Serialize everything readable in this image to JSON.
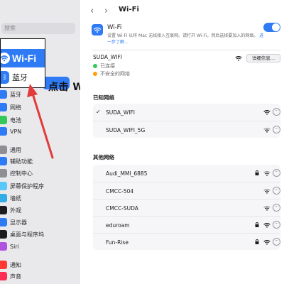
{
  "sidebar": {
    "search_placeholder": "搜索",
    "items": [
      {
        "label": "蓝牙",
        "icon": "bluetooth-icon",
        "color": "#2f7bf6"
      },
      {
        "label": "网络",
        "icon": "globe-icon",
        "color": "#2f7bf6"
      },
      {
        "label": "电池",
        "icon": "battery-icon",
        "color": "#34c759"
      },
      {
        "label": "VPN",
        "icon": "vpn-icon",
        "color": "#2f7bf6"
      },
      {
        "label": "通用",
        "icon": "gear-icon",
        "color": "#8e8e93"
      },
      {
        "label": "辅助功能",
        "icon": "accessibility-icon",
        "color": "#2f7bf6"
      },
      {
        "label": "控制中心",
        "icon": "control-center-icon",
        "color": "#8e8e93"
      },
      {
        "label": "屏幕保护程序",
        "icon": "screensaver-icon",
        "color": "#5ac8fa"
      },
      {
        "label": "墙纸",
        "icon": "wallpaper-icon",
        "color": "#32ade6"
      },
      {
        "label": "外观",
        "icon": "appearance-icon",
        "color": "#1c1c1e"
      },
      {
        "label": "显示器",
        "icon": "display-icon",
        "color": "#2f7bf6"
      },
      {
        "label": "桌面与程序坞",
        "icon": "dock-icon",
        "color": "#1c1c1e"
      },
      {
        "label": "Siri",
        "icon": "siri-icon",
        "color": "#af52de"
      },
      {
        "label": "通知",
        "icon": "bell-icon",
        "color": "#ff3b30"
      },
      {
        "label": "声音",
        "icon": "speaker-icon",
        "color": "#ff2d55"
      }
    ]
  },
  "callout": {
    "wifi_label": "Wi-Fi",
    "bluetooth_label": "蓝牙",
    "annotation": "点击 Wi-Fi"
  },
  "header": {
    "back": "‹",
    "forward": "›",
    "title": "Wi-Fi"
  },
  "wifi_card": {
    "title": "Wi-Fi",
    "description": "设置 Wi-Fi 以将 Mac 无线接入互联网。请打开 Wi-Fi，然后选择要加入的网络。",
    "link": "进一步了解…",
    "enabled": true
  },
  "current_network": {
    "name": "SUDA_WIFI",
    "status_connected": "已连接",
    "status_insecure": "不安全的网络",
    "details_button": "详细信息…",
    "connected_color": "#34c759",
    "insecure_color": "#ff9f0a"
  },
  "known_networks": {
    "title": "已知网络",
    "items": [
      {
        "name": "SUDA_WIFI",
        "checked": "✓",
        "locked": false
      },
      {
        "name": "SUDA_WIFI_5G",
        "checked": "",
        "locked": false
      }
    ]
  },
  "other_networks": {
    "title": "其他网络",
    "items": [
      {
        "name": "Audi_MMI_6885",
        "locked": true
      },
      {
        "name": "CMCC-504",
        "locked": false
      },
      {
        "name": "CMCC-SUDA",
        "locked": false
      },
      {
        "name": "eduroam",
        "locked": true
      },
      {
        "name": "Fun-Rise",
        "locked": true
      }
    ]
  },
  "more_label": "···"
}
